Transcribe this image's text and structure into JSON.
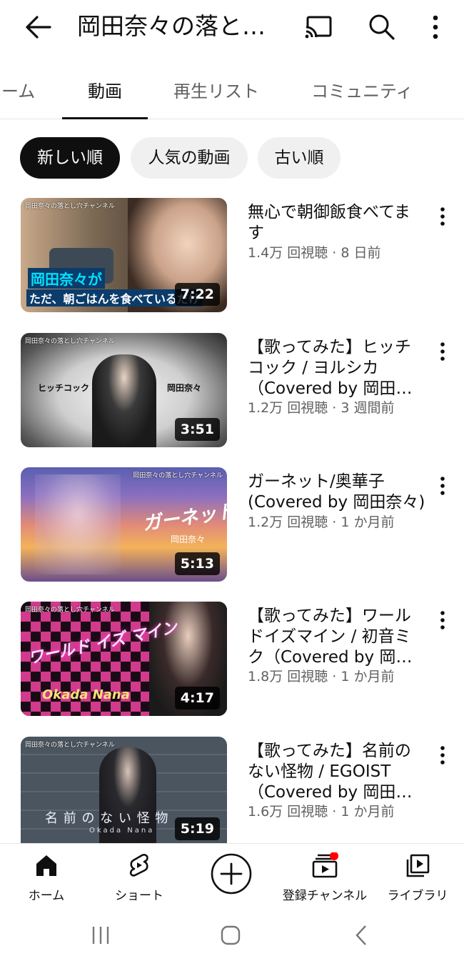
{
  "header": {
    "title": "岡田奈々の落とし穴チャンネル",
    "back_icon": "arrow-left-icon",
    "cast_icon": "cast-icon",
    "search_icon": "search-icon",
    "more_icon": "more-vert-icon"
  },
  "tabs": [
    {
      "label": "ホーム"
    },
    {
      "label": "動画",
      "active": true
    },
    {
      "label": "再生リスト"
    },
    {
      "label": "コミュニティ"
    }
  ],
  "chips": [
    {
      "label": "新しい順",
      "selected": true
    },
    {
      "label": "人気の動画"
    },
    {
      "label": "古い順"
    }
  ],
  "videos": [
    {
      "title": "無心で朝御飯食べてます",
      "meta": "1.4万 回視聴 · 8 日前",
      "duration": "7:22",
      "thumb_channel": "岡田奈々の落とし穴チャンネル",
      "thumb_caption_1": "岡田奈々が",
      "thumb_caption_2": "ただ、朝ごはんを食べているだけ"
    },
    {
      "title": "【歌ってみた】ヒッチコック / ヨルシカ（Covered by 岡田奈々）",
      "meta": "1.2万 回視聴 · 3 週間前",
      "duration": "3:51",
      "thumb_channel": "岡田奈々の落とし穴チャンネル",
      "thumb_caption_1": "ヒッチコック",
      "thumb_caption_2": "岡田奈々"
    },
    {
      "title": "ガーネット/奥華子 (Covered by 岡田奈々)",
      "meta": "1.2万 回視聴 · 1 か月前",
      "duration": "5:13",
      "thumb_channel": "岡田奈々の落とし穴チャンネル",
      "thumb_caption_1": "ガーネット",
      "thumb_caption_2": "岡田奈々"
    },
    {
      "title": "【歌ってみた】ワールドイズマイン / 初音ミク（Covered by 岡田奈々）",
      "meta": "1.8万 回視聴 · 1 か月前",
      "duration": "4:17",
      "thumb_channel": "岡田奈々の落とし穴チャンネル",
      "thumb_caption_1": "ワールド イズ マイン",
      "thumb_caption_2": "Okada Nana"
    },
    {
      "title": "【歌ってみた】名前のない怪物 / EGOIST（Covered by 岡田奈々）",
      "meta": "1.6万 回視聴 · 1 か月前",
      "duration": "5:19",
      "thumb_channel": "岡田奈々の落とし穴チャンネル",
      "thumb_caption_1": "名 前 の な い 怪 物",
      "thumb_caption_2": "Okada Nana"
    }
  ],
  "bottom_nav": [
    {
      "label": "ホーム",
      "icon": "home-icon"
    },
    {
      "label": "ショート",
      "icon": "shorts-icon"
    },
    {
      "label": "",
      "icon": "create-plus-icon"
    },
    {
      "label": "登録チャンネル",
      "icon": "subscriptions-icon",
      "badge": true
    },
    {
      "label": "ライブラリ",
      "icon": "library-icon"
    }
  ],
  "system_nav": [
    "recents-icon",
    "home-circle-icon",
    "back-chevron-icon"
  ],
  "colors": {
    "accent": "#0f0f0f",
    "badge": "#ff0000",
    "secondary_text": "#606060"
  }
}
